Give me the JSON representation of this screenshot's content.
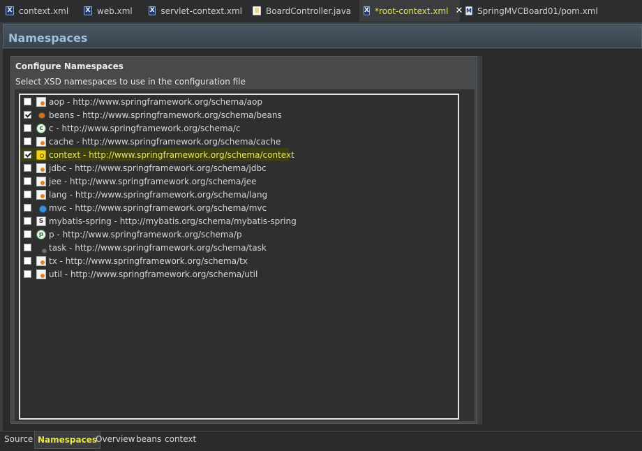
{
  "editor_tabs": [
    {
      "label": "context.xml",
      "icon": "xml-file-icon",
      "active": false
    },
    {
      "label": "web.xml",
      "icon": "xml-file-icon",
      "active": false
    },
    {
      "label": "servlet-context.xml",
      "icon": "spring-xml-file-icon",
      "active": false
    },
    {
      "label": "BoardController.java",
      "icon": "java-file-icon",
      "active": false
    },
    {
      "label": "*root-context.xml",
      "icon": "spring-xml-file-icon",
      "active": true,
      "close": "✕"
    },
    {
      "label": "SpringMVCBoard01/pom.xml",
      "icon": "maven-pom-icon",
      "active": false
    }
  ],
  "header": {
    "title": "Namespaces"
  },
  "section": {
    "title": "Configure Namespaces",
    "description": "Select XSD namespaces to use in the configuration file"
  },
  "namespaces": [
    {
      "label": "aop - http://www.springframework.org/schema/aop",
      "checked": false,
      "icon": "aop-icon"
    },
    {
      "label": "beans - http://www.springframework.org/schema/beans",
      "checked": true,
      "icon": "bean-icon"
    },
    {
      "label": "c - http://www.springframework.org/schema/c",
      "checked": false,
      "icon": "c-namespace-icon"
    },
    {
      "label": "cache - http://www.springframework.org/schema/cache",
      "checked": false,
      "icon": "cache-icon"
    },
    {
      "label": "context - http://www.springframework.org/schema/context",
      "checked": true,
      "icon": "context-icon",
      "selected": true
    },
    {
      "label": "jdbc - http://www.springframework.org/schema/jdbc",
      "checked": false,
      "icon": "jdbc-icon"
    },
    {
      "label": "jee - http://www.springframework.org/schema/jee",
      "checked": false,
      "icon": "jee-icon"
    },
    {
      "label": "lang - http://www.springframework.org/schema/lang",
      "checked": false,
      "icon": "lang-icon"
    },
    {
      "label": "mvc - http://www.springframework.org/schema/mvc",
      "checked": false,
      "icon": "mvc-globe-icon"
    },
    {
      "label": "mybatis-spring - http://mybatis.org/schema/mybatis-spring",
      "checked": false,
      "icon": "mybatis-icon"
    },
    {
      "label": "p - http://www.springframework.org/schema/p",
      "checked": false,
      "icon": "p-namespace-icon"
    },
    {
      "label": "task - http://www.springframework.org/schema/task",
      "checked": false,
      "icon": "task-icon"
    },
    {
      "label": "tx - http://www.springframework.org/schema/tx",
      "checked": false,
      "icon": "tx-icon"
    },
    {
      "label": "util - http://www.springframework.org/schema/util",
      "checked": false,
      "icon": "util-icon"
    }
  ],
  "bottom_tabs": [
    {
      "label": "Source",
      "active": false
    },
    {
      "label": "Namespaces",
      "active": true
    },
    {
      "label": "Overview",
      "active": false
    },
    {
      "label": "beans",
      "active": false
    },
    {
      "label": "context",
      "active": false
    }
  ],
  "colors": {
    "selection_text": "#e8e64a",
    "header_text": "#9cc1e0"
  }
}
